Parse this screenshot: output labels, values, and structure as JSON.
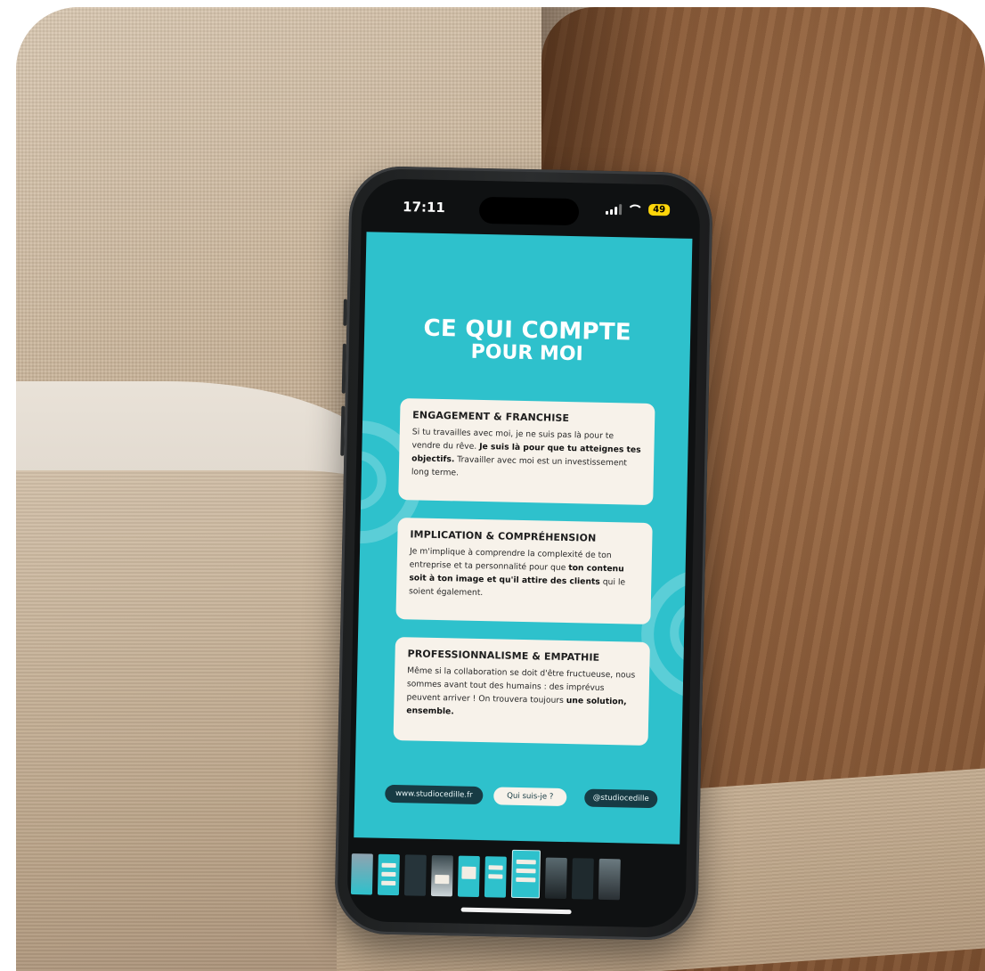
{
  "phone": {
    "time": "17:11",
    "battery": "49"
  },
  "slide": {
    "title_line1": "CE QUI COMPTE",
    "title_line2": "POUR MOI",
    "cards": [
      {
        "heading": "ENGAGEMENT & FRANCHISE",
        "t1": "Si tu travailles avec moi, je ne suis pas là pour te vendre du rêve. ",
        "b1": "Je suis là pour que tu atteignes tes objectifs.",
        "t2": " Travailler avec moi est un investissement long terme.",
        "b2": "",
        "t3": ""
      },
      {
        "heading": "IMPLICATION & COMPRÉHENSION",
        "t1": "Je m'implique à comprendre la complexité de ton entreprise et ta personnalité pour que ",
        "b1": "ton contenu soit à ton image et qu'il attire des clients",
        "t2": " qui le soient également.",
        "b2": "",
        "t3": ""
      },
      {
        "heading": "PROFESSIONNALISME & EMPATHIE",
        "t1": "Même si la collaboration se doit d'être fructueuse, nous sommes avant tout des humains : des imprévus peuvent arriver ! On trouvera toujours ",
        "b1": "une solution, ensemble.",
        "t2": "",
        "b2": "",
        "t3": ""
      }
    ],
    "links": {
      "website": "www.studiocedille.fr",
      "about": "Qui suis-je ?",
      "handle": "@studiocedille"
    }
  },
  "colors": {
    "slide_bg": "#2ec1cc",
    "card_bg": "#f7f2ea",
    "pill_dark": "#173b44"
  },
  "thumbnails": [
    "thumb-1",
    "thumb-2",
    "thumb-3",
    "thumb-4",
    "thumb-5",
    "thumb-6",
    "thumb-7-selected",
    "thumb-8",
    "thumb-9",
    "thumb-10"
  ]
}
